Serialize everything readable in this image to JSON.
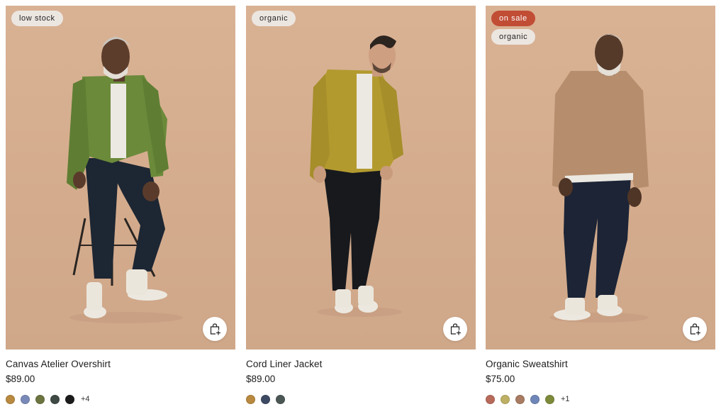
{
  "products": [
    {
      "name": "Canvas Atelier Overshirt",
      "price": "$89.00",
      "badges": [
        {
          "label": "low stock",
          "type": "default"
        }
      ],
      "swatches": [
        "#b8893f",
        "#7a8ab8",
        "#6c7440",
        "#3f4a45",
        "#1b1b1b"
      ],
      "more": "+4",
      "cart_icon": "shopping-bag-plus-icon"
    },
    {
      "name": "Cord Liner Jacket",
      "price": "$89.00",
      "badges": [
        {
          "label": "organic",
          "type": "default"
        }
      ],
      "swatches": [
        "#b8893f",
        "#3e4a63",
        "#4b5754"
      ],
      "more": "",
      "cart_icon": "shopping-bag-plus-icon"
    },
    {
      "name": "Organic Sweatshirt",
      "price": "$75.00",
      "badges": [
        {
          "label": "on sale",
          "type": "sale"
        },
        {
          "label": "organic",
          "type": "default"
        }
      ],
      "swatches": [
        "#b86a5a",
        "#bdb064",
        "#a87b62",
        "#6f86b8",
        "#7c8a3a"
      ],
      "more": "+1",
      "cart_icon": "shopping-bag-plus-icon"
    }
  ],
  "colors": {
    "sale_badge": "#c14d35",
    "default_badge": "#ece6e1",
    "photo_background": "#d6ae90"
  }
}
